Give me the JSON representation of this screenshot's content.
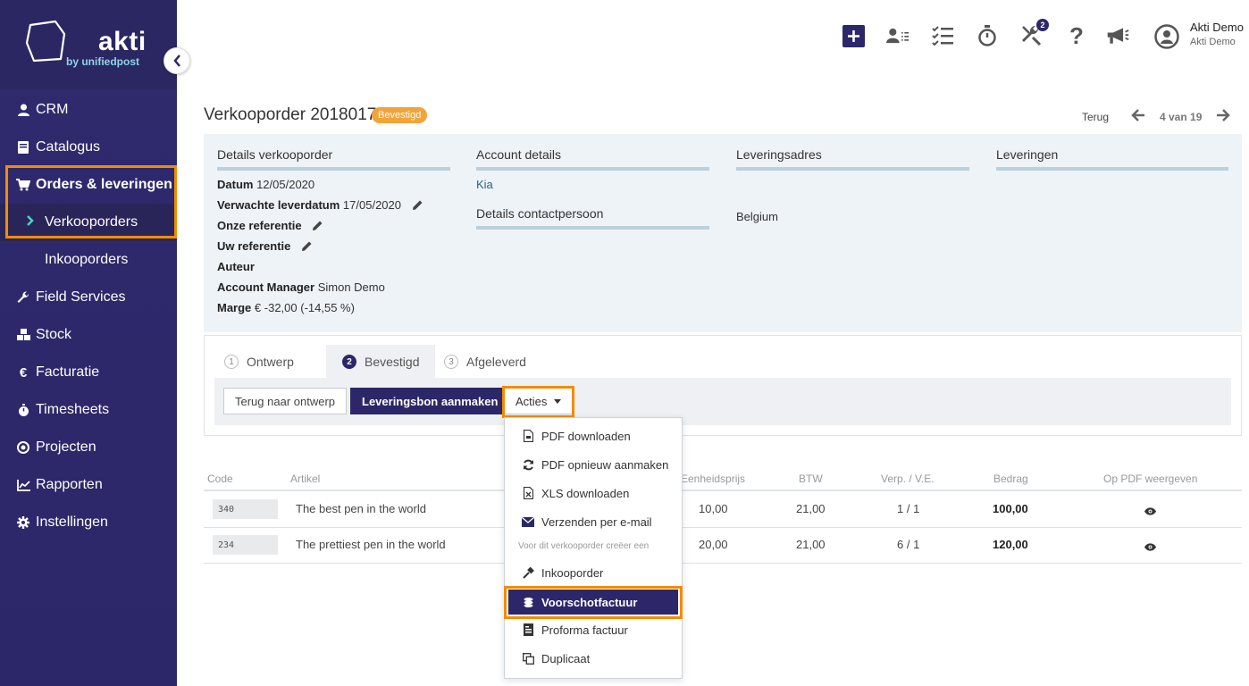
{
  "brand": {
    "name": "akti",
    "sub": "by unifiedpost"
  },
  "sidebar": {
    "items": [
      {
        "label": "CRM",
        "icon": "user-icon"
      },
      {
        "label": "Catalogus",
        "icon": "book-icon"
      },
      {
        "label": "Orders & leveringen",
        "icon": "cart-icon"
      },
      {
        "label": "Verkooporders",
        "icon": "chevron-right-icon"
      },
      {
        "label": "Inkooporders",
        "icon": ""
      },
      {
        "label": "Field Services",
        "icon": "wrench-icon"
      },
      {
        "label": "Stock",
        "icon": "cubes-icon"
      },
      {
        "label": "Facturatie",
        "icon": "euro-icon"
      },
      {
        "label": "Timesheets",
        "icon": "stopwatch-icon"
      },
      {
        "label": "Projecten",
        "icon": "target-icon"
      },
      {
        "label": "Rapporten",
        "icon": "line-chart-icon"
      },
      {
        "label": "Instellingen",
        "icon": "gear-icon"
      }
    ]
  },
  "topbar": {
    "badge_count": "2",
    "user_name": "Akti Demo",
    "user_company": "Akti Demo"
  },
  "header": {
    "title": "Verkooporder 2018017",
    "status": "Bevestigd",
    "back_label": "Terug",
    "pager": "4 van 19"
  },
  "details": {
    "order_heading": "Details verkooporder",
    "account_heading": "Account details",
    "address_heading": "Leveringsadres",
    "deliveries_heading": "Leveringen",
    "contact_heading": "Details contactpersoon",
    "account_name": "Kia",
    "address_country": "Belgium",
    "fields": [
      {
        "label": "Datum",
        "value": "12/05/2020"
      },
      {
        "label": "Verwachte leverdatum",
        "value": "17/05/2020"
      },
      {
        "label": "Onze referentie",
        "value": ""
      },
      {
        "label": "Uw referentie",
        "value": ""
      },
      {
        "label": "Auteur",
        "value": ""
      },
      {
        "label": "Account Manager",
        "value": "Simon Demo"
      },
      {
        "label": "Marge",
        "value": "€ -32,00 (-14,55 %)"
      }
    ]
  },
  "steps": [
    {
      "num": "1",
      "label": "Ontwerp"
    },
    {
      "num": "2",
      "label": "Bevestigd"
    },
    {
      "num": "3",
      "label": "Afgeleverd"
    }
  ],
  "buttons": {
    "back_to_draft": "Terug naar ontwerp",
    "create_delivery": "Leveringsbon aanmaken",
    "actions": "Acties"
  },
  "table": {
    "headers": [
      "Code",
      "Artikel",
      "Eenheidsprijs",
      "BTW",
      "Verp. / V.E.",
      "Bedrag",
      "Op PDF weergeven"
    ],
    "rows": [
      {
        "code": "340",
        "article": "The best pen in the world",
        "unit_price": "10,00",
        "vat": "21,00",
        "pack": "1 / 1",
        "amount": "100,00"
      },
      {
        "code": "234",
        "article": "The prettiest pen in the world",
        "unit_price": "20,00",
        "vat": "21,00",
        "pack": "6 / 1",
        "amount": "120,00"
      }
    ]
  },
  "dropdown": {
    "items": [
      {
        "label": "PDF downloaden",
        "icon": "pdf-file-icon"
      },
      {
        "label": "PDF opnieuw aanmaken",
        "icon": "refresh-icon"
      },
      {
        "label": "XLS downloaden",
        "icon": "excel-file-icon"
      },
      {
        "label": "Verzenden per e-mail",
        "icon": "envelope-icon"
      }
    ],
    "section_label": "Voor dit verkooporder creëer een",
    "create_items": [
      {
        "label": "Inkooporder",
        "icon": "hammer-icon"
      },
      {
        "label": "Voorschotfactuur",
        "icon": "coins-icon"
      },
      {
        "label": "Proforma factuur",
        "icon": "invoice-icon"
      },
      {
        "label": "Duplicaat",
        "icon": "copy-icon"
      }
    ]
  },
  "colors": {
    "sidebar": "#2c2768",
    "accent": "#f28c00",
    "status": "#f2a33a",
    "teal": "#48d3c4"
  }
}
